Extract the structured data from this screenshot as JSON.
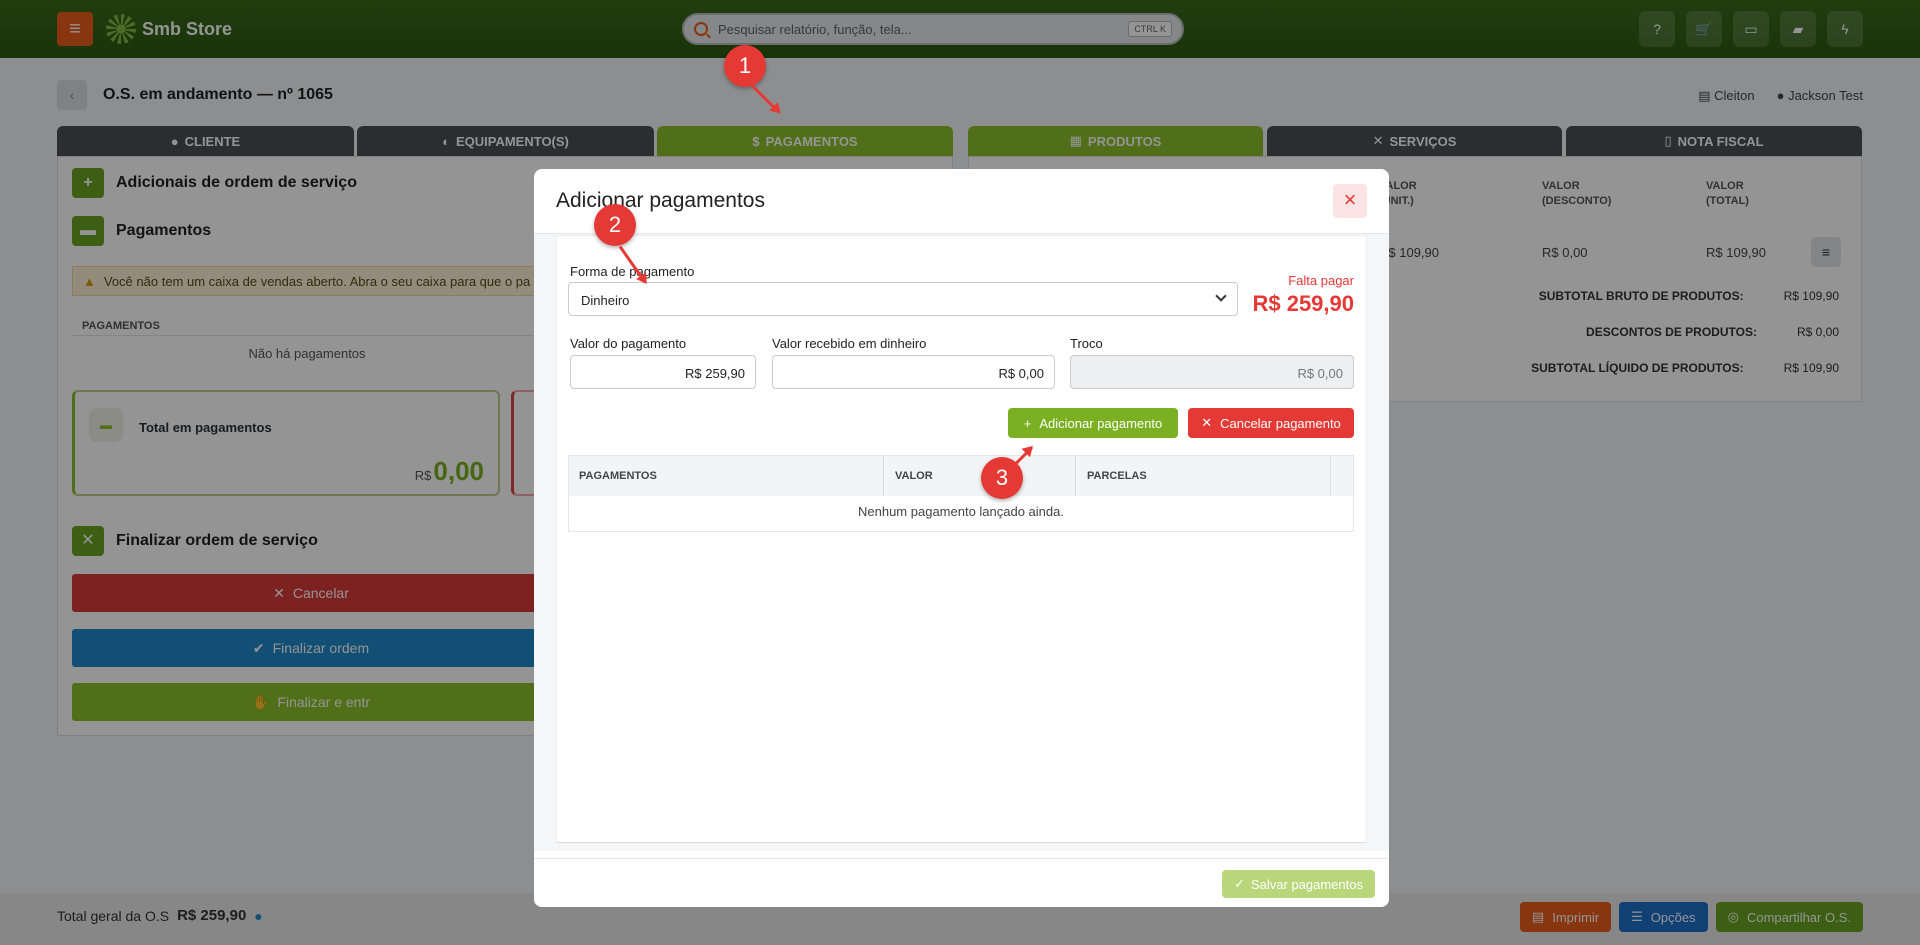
{
  "topbar": {
    "menu_icon": "hamburger-icon",
    "brand": "Smb Store",
    "search_placeholder": "Pesquisar relatório, função, tela...",
    "search_shortcut": "CTRL K",
    "icons": [
      "help-icon",
      "cart-icon",
      "monitor-icon",
      "chat-icon",
      "lightning-icon"
    ]
  },
  "page": {
    "title": "O.S. em andamento — nº 1065",
    "user_store": "Cleiton",
    "user_name": "Jackson Test"
  },
  "tabs": [
    {
      "label": "CLIENTE",
      "active": false
    },
    {
      "label": "EQUIPAMENTO(S)",
      "active": false
    },
    {
      "label": "PAGAMENTOS",
      "active": true
    },
    {
      "label": "PRODUTOS",
      "active": false
    },
    {
      "label": "SERVIÇOS",
      "active": false
    },
    {
      "label": "NOTA FISCAL",
      "active": false
    }
  ],
  "left": {
    "adicionais_title": "Adicionais de ordem de serviço",
    "pagamentos_title": "Pagamentos",
    "warning": "Você não tem um caixa de vendas aberto. Abra o seu caixa para que o pa",
    "table_header": "PAGAMENTOS",
    "empty": "Não há pagamentos",
    "total_label": "Total em pagamentos",
    "total_currency": "R$",
    "total_value": "0,00",
    "finalizar_title": "Finalizar ordem de serviço",
    "btn_cancelar": "Cancelar",
    "btn_finalizar": "Finalizar ordem",
    "btn_entregar": "Finalizar e entr"
  },
  "right": {
    "headers": [
      "VALOR\n(UNIT.)",
      "VALOR\n(DESCONTO)",
      "VALOR\n(TOTAL)"
    ],
    "row": [
      "R$ 109,90",
      "R$ 0,00",
      "R$ 109,90"
    ],
    "subtotal_bruto_label": "SUBTOTAL BRUTO DE PRODUTOS:",
    "subtotal_bruto": "R$ 109,90",
    "descontos_label": "DESCONTOS DE PRODUTOS:",
    "descontos": "R$ 0,00",
    "subtotal_liquido_label": "SUBTOTAL LÍQUIDO DE PRODUTOS:",
    "subtotal_liquido": "R$ 109,90"
  },
  "bottom": {
    "total_label": "Total geral da O.S",
    "total_value": "R$ 259,90",
    "btn_imprimir": "Imprimir",
    "btn_opcoes": "Opções",
    "btn_compartilhar": "Compartilhar O.S."
  },
  "modal": {
    "title": "Adicionar pagamentos",
    "forma_label": "Forma de pagamento",
    "forma_value": "Dinheiro",
    "falta_label": "Falta pagar",
    "falta_value": "R$ 259,90",
    "valor_label": "Valor do pagamento",
    "valor_value": "R$ 259,90",
    "recebido_label": "Valor recebido em dinheiro",
    "recebido_value": "R$ 0,00",
    "troco_label": "Troco",
    "troco_value": "R$ 0,00",
    "btn_add": "Adicionar pagamento",
    "btn_cancel": "Cancelar pagamento",
    "table_headers": [
      "PAGAMENTOS",
      "VALOR",
      "PARCELAS"
    ],
    "table_empty": "Nenhum pagamento lançado ainda.",
    "btn_save": "Salvar pagamentos"
  },
  "markers": [
    "1",
    "2",
    "3"
  ],
  "colors": {
    "green": "#8bbf2a",
    "red": "#e53935",
    "orange": "#e85d1a",
    "blue": "#1e88c8",
    "dark": "#4a4f55"
  }
}
